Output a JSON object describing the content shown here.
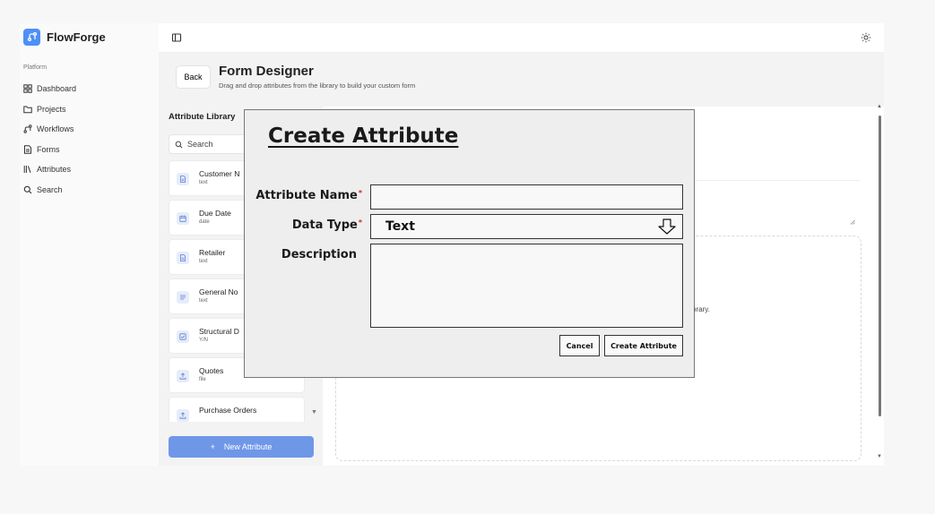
{
  "app": {
    "name": "FlowForge"
  },
  "sidebar": {
    "section_label": "Platform",
    "items": [
      {
        "label": "Dashboard",
        "icon": "grid-icon"
      },
      {
        "label": "Projects",
        "icon": "folder-icon"
      },
      {
        "label": "Workflows",
        "icon": "workflow-icon"
      },
      {
        "label": "Forms",
        "icon": "form-icon"
      },
      {
        "label": "Attributes",
        "icon": "library-icon"
      },
      {
        "label": "Search",
        "icon": "search-icon"
      }
    ]
  },
  "header": {
    "back_label": "Back",
    "title": "Form Designer",
    "subtitle": "Drag and drop attributes from the library to build your custom form"
  },
  "library": {
    "title": "Attribute Library",
    "search_placeholder": "Search",
    "items": [
      {
        "name": "Customer N",
        "type": "text",
        "icon": "document-icon"
      },
      {
        "name": "Due Date",
        "type": "date",
        "icon": "calendar-icon"
      },
      {
        "name": "Retailer",
        "type": "text",
        "icon": "document-icon"
      },
      {
        "name": "General No",
        "type": "text",
        "icon": "paragraph-icon"
      },
      {
        "name": "Structural D",
        "type": "Y/N",
        "icon": "checkbox-icon"
      },
      {
        "name": "Quotes",
        "type": "file",
        "icon": "upload-icon"
      },
      {
        "name": "Purchase Orders",
        "type": "",
        "icon": "upload-icon"
      }
    ],
    "new_button_icon": "+",
    "new_button_label": "New Attribute"
  },
  "canvas": {
    "dropzone_text": "brary."
  },
  "modal": {
    "title": "Create Attribute",
    "name_label": "Attribute Name",
    "name_value": "",
    "type_label": "Data Type",
    "type_value": "Text",
    "description_label": "Description",
    "description_value": "",
    "required_mark": "*",
    "cancel_label": "Cancel",
    "submit_label": "Create Attribute"
  },
  "colors": {
    "accent": "#4f8ff7",
    "new_button": "#6f97e8",
    "required": "#cc2222"
  }
}
